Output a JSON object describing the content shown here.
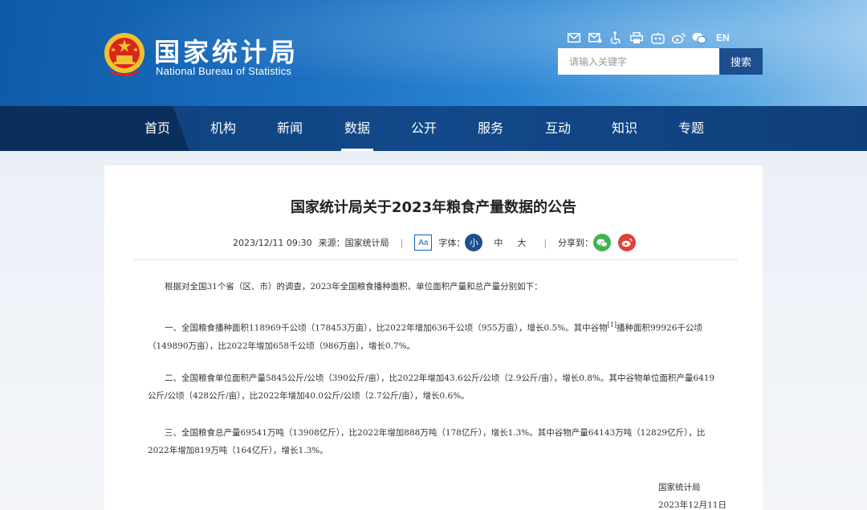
{
  "header": {
    "logo_cn": "国家统计局",
    "logo_en": "National Bureau of Statistics",
    "tools": [
      "mail-icon",
      "feedback-mail-icon",
      "accessibility-icon",
      "print-icon",
      "robot-icon",
      "weibo-icon",
      "wechat-icon"
    ],
    "lang_label": "EN",
    "search_placeholder": "请输入关键字",
    "search_button": "搜索"
  },
  "nav": {
    "items": [
      "首页",
      "机构",
      "新闻",
      "数据",
      "公开",
      "服务",
      "互动",
      "知识",
      "专题"
    ],
    "active": "数据"
  },
  "article": {
    "title": "国家统计局关于2023年粮食产量数据的公告",
    "datetime": "2023/12/11 09:30",
    "source_label": "来源：",
    "source": "国家统计局",
    "font_label": "字体：",
    "aa_label": "Aa",
    "font_small": "小",
    "font_medium": "中",
    "font_large": "大",
    "share_label": "分享到：",
    "intro": "根据对全国31个省（区、市）的调查，2023年全国粮食播种面积、单位面积产量和总产量分别如下：",
    "p1_a": "一、全国粮食播种面积118969千公顷（178453万亩），比2022年增加636千公顷（955万亩），增长0.5%。其中谷物",
    "p1_sup": "[1]",
    "p1_b": "播种面积99926千公顷（149890万亩），比2022年增加658千公顷（986万亩），增长0.7%。",
    "p2": "二、全国粮食单位面积产量5845公斤/公顷（390公斤/亩），比2022年增加43.6公斤/公顷（2.9公斤/亩），增长0.8%。其中谷物单位面积产量6419公斤/公顷（428公斤/亩），比2022年增加40.0公斤/公顷（2.7公斤/亩），增长0.6%。",
    "p3": "三、全国粮食总产量69541万吨（13908亿斤），比2022年增加888万吨（178亿斤），增长1.3%。其中谷物产量64143万吨（12829亿斤），比2022年增加819万吨（164亿斤），增长1.3%。",
    "sign_org": "国家统计局",
    "sign_date": "2023年12月11日"
  }
}
